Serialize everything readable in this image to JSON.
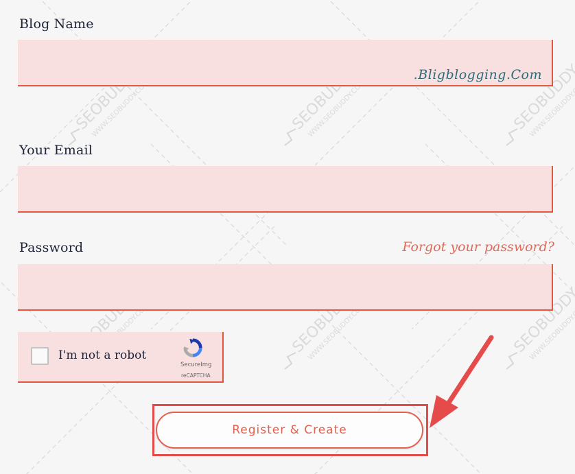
{
  "form": {
    "blog_name_label": "Blog Name",
    "blog_name_value": "",
    "site_watermark": ".Bligblogging.Com",
    "email_label": "Your Email",
    "email_value": "",
    "password_label": "Password",
    "password_value": "",
    "forgot_link": "Forgot your password?",
    "captcha": {
      "label": "I'm not a robot",
      "brand_line1": "SecureImg",
      "brand_line2": "reCAPTCHA"
    },
    "register_button": "Register & Create"
  },
  "watermark": {
    "text": "SEOBUDDY",
    "url": "WWW.SEOBUDDY.COM"
  },
  "colors": {
    "field_bg": "#f8e0e0",
    "accent": "#e0583f",
    "annotation_red": "#e54b4b",
    "label_text": "#1f2338"
  }
}
